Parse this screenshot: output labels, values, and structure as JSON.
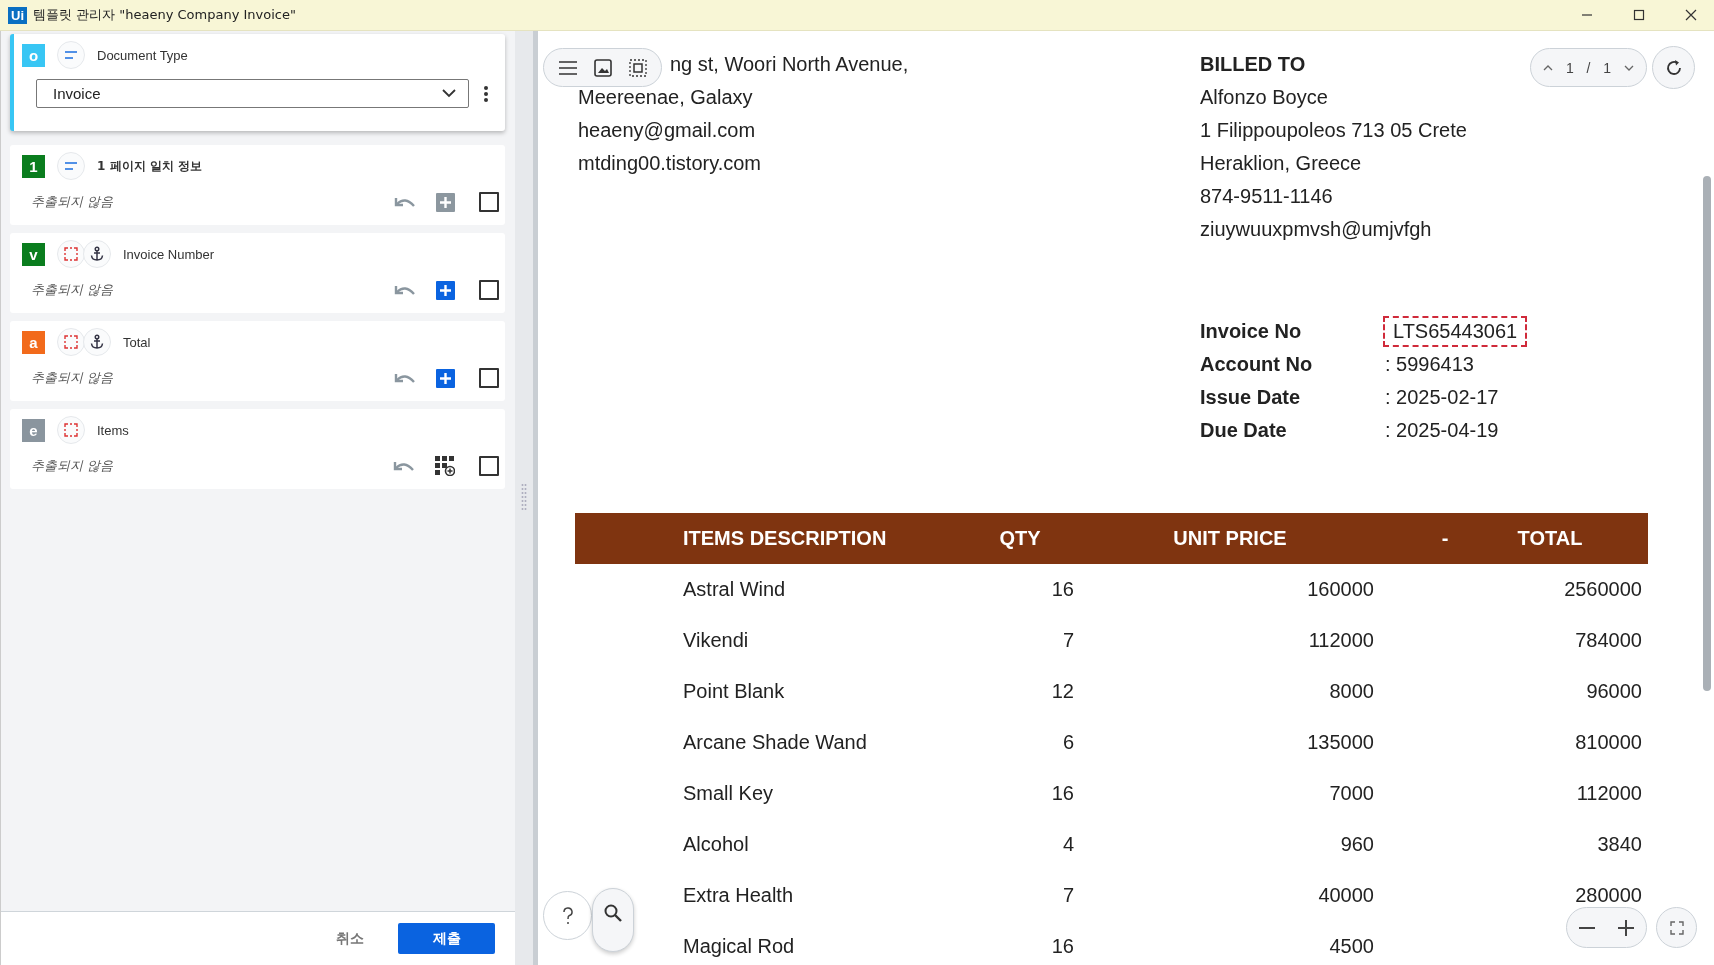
{
  "window": {
    "logo": "Ui",
    "title": "템플릿 관리자 \"heaeny Company Invoice\""
  },
  "document_type": {
    "badge": "o",
    "color": "#38c6f4",
    "label": "Document Type",
    "value": "Invoice",
    "selected": true
  },
  "fields": [
    {
      "badge": "1",
      "color": "#0a7d1e",
      "icons": [
        {
          "kind": "list"
        }
      ],
      "label": "1 페이지 일치 정보",
      "bold": true,
      "status": "추출되지 않음",
      "action": {
        "kind": "add",
        "disabled": true
      },
      "checked": false
    },
    {
      "badge": "v",
      "color": "#0a7d1e",
      "icons": [
        {
          "kind": "region"
        },
        {
          "kind": "anchor"
        }
      ],
      "label": "Invoice Number",
      "bold": false,
      "status": "추출되지 않음",
      "action": {
        "kind": "add",
        "disabled": false
      },
      "checked": false
    },
    {
      "badge": "a",
      "color": "#f26a1b",
      "icons": [
        {
          "kind": "region"
        },
        {
          "kind": "anchor"
        }
      ],
      "label": "Total",
      "bold": false,
      "status": "추출되지 않음",
      "action": {
        "kind": "add",
        "disabled": false
      },
      "checked": false
    },
    {
      "badge": "e",
      "color": "#8a959e",
      "icons": [
        {
          "kind": "region"
        }
      ],
      "label": "Items",
      "bold": false,
      "status": "추출되지 않음",
      "action": {
        "kind": "table",
        "disabled": false
      },
      "checked": false
    }
  ],
  "footer": {
    "cancel": "취소",
    "submit": "제출"
  },
  "pager": {
    "page": "1",
    "separator": "/",
    "total": "1"
  },
  "document": {
    "sender_lines": [
      "ng st, Woori North Avenue,",
      "Meereenae, Galaxy",
      "heaeny@gmail.com",
      "mtding00.tistory.com"
    ],
    "billed_to": {
      "title": "BILLED TO",
      "lines": [
        "Alfonzo Boyce",
        "1 Filippoupoleos 713 05 Crete",
        "Heraklion, Greece",
        "874-9511-1146",
        "ziuywuuxpmvsh@umjvfgh"
      ]
    },
    "details": [
      {
        "label": "Invoice No",
        "value": "LTS65443061",
        "highlighted": true
      },
      {
        "label": "Account No",
        "value": ": 5996413",
        "highlighted": false
      },
      {
        "label": "Issue Date",
        "value": ": 2025-02-17",
        "highlighted": false
      },
      {
        "label": "Due Date",
        "value": ": 2025-04-19",
        "highlighted": false
      }
    ],
    "table": {
      "columns": [
        "ITEMS DESCRIPTION",
        "QTY",
        "UNIT PRICE",
        "-",
        "TOTAL"
      ],
      "rows": [
        [
          "Astral Wind",
          "16",
          "160000",
          "2560000"
        ],
        [
          "Vikendi",
          "7",
          "112000",
          "784000"
        ],
        [
          "Point Blank",
          "12",
          "8000",
          "96000"
        ],
        [
          "Arcane Shade Wand",
          "6",
          "135000",
          "810000"
        ],
        [
          "Small Key",
          "16",
          "7000",
          "112000"
        ],
        [
          "Alcohol",
          "4",
          "960",
          "3840"
        ],
        [
          "Extra Health",
          "7",
          "40000",
          "280000"
        ],
        [
          "Magical Rod",
          "16",
          "4500"
        ]
      ]
    }
  }
}
